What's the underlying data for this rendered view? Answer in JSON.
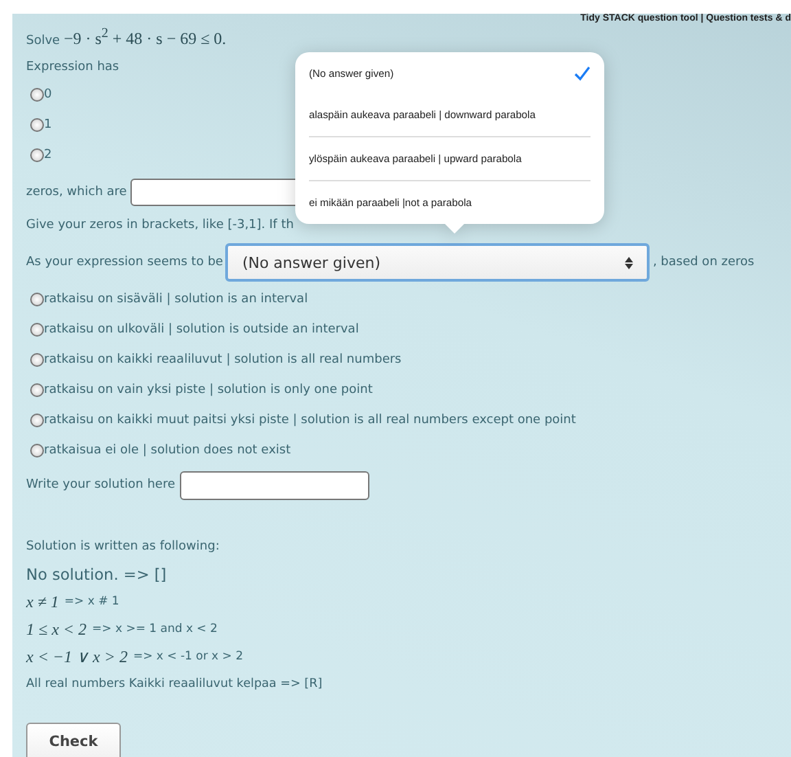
{
  "header": {
    "links": "Tidy STACK question tool | Question tests & d"
  },
  "question": {
    "prefix": "Solve",
    "math": "−9 · s$^{2}$ + 48 · s − 69 ≤ 0."
  },
  "zeros_intro": "Expression has",
  "zero_options": [
    {
      "label": "0",
      "selected": false
    },
    {
      "label": "1",
      "selected": false
    },
    {
      "label": "2",
      "selected": false
    }
  ],
  "zeros_field": {
    "label": "zeros, which are"
  },
  "hint": "Give your zeros in brackets, like [-3,1]. If th",
  "shape_row": {
    "label_before": "As your expression seems to be",
    "value": "(No answer given)",
    "label_after": ", based on zeros"
  },
  "dropdown": [
    {
      "label": "(No answer given)",
      "selected": true
    },
    {
      "label": "alaspäin aukeava paraabeli | downward parabola",
      "selected": false
    },
    {
      "label": "ylöspäin aukeava paraabeli | upward parabola",
      "selected": false
    },
    {
      "label": "ei mikään paraabeli |not a parabola",
      "selected": false
    }
  ],
  "solution_options": [
    {
      "label": "ratkaisu on sisäväli | solution is an interval",
      "selected": false
    },
    {
      "label": "ratkaisu on ulkoväli | solution is outside an interval",
      "selected": false
    },
    {
      "label": "ratkaisu on kaikki reaaliluvut | solution is all real numbers",
      "selected": false
    },
    {
      "label": "ratkaisu on vain yksi piste | solution is only one point",
      "selected": false
    },
    {
      "label": "ratkaisu on kaikki muut paitsi yksi piste | solution is all real numbers except one point",
      "selected": false
    },
    {
      "label": "ratkaisua ei ole | solution does not exist",
      "selected": false
    }
  ],
  "solution_field": {
    "label": "Write your solution here"
  },
  "format_title": "Solution is written as following:",
  "format_examples": [
    {
      "kind": "plain",
      "text": "No solution. => []"
    },
    {
      "kind": "math",
      "math": "x ≠ 1",
      "text": "=> x # 1"
    },
    {
      "kind": "math",
      "math": "1 ≤ x < 2",
      "text": "=> x >= 1 and x < 2"
    },
    {
      "kind": "math",
      "math": "x < −1 ∨ x > 2",
      "text": "=> x < -1 or x > 2"
    },
    {
      "kind": "small",
      "text": "All real numbers Kaikki reaaliluvut kelpaa => [R]"
    }
  ],
  "check_button": "Check"
}
